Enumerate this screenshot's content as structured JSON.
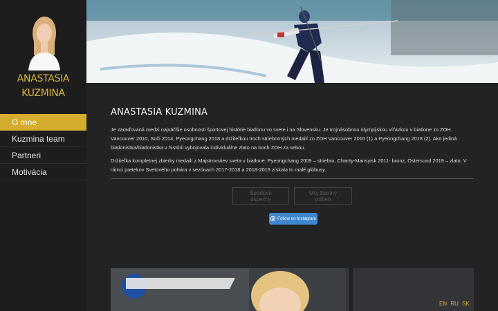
{
  "sidebar": {
    "name_line1": "ANASTASIA",
    "name_line2": "KUZMINA",
    "items": [
      {
        "label": "O mne",
        "active": true
      },
      {
        "label": "Kuzmina team",
        "active": false
      },
      {
        "label": "Partneri",
        "active": false
      },
      {
        "label": "Motivácia",
        "active": false
      }
    ]
  },
  "main": {
    "title": "ANASTASIA KUZMINA",
    "paragraph1": "Je zaraďovaná medzi najväčšie osobnosti športovej histórie biatlonu vo svete i na Slovensku. Je trojnásobnou olympijskou víťazkou v biatlone zo ZOH Vancouver 2010, Soči 2014, Pyeongchang 2018 a držiteľkou troch strieborných medailí zo ZOH Vancouver 2010 (1) a Pyeongchang 2018 (2).  Ako jediná biatlonistka/biatlonistka v histórii vybojovala individuálne zlato na troch ZOH za sebou.",
    "paragraph2": "Držiteľka kompletnej zbierky medailí z Majstrovstiev sveta v biatlone: Pyeongchang 2009 – striebro, Chanty-Mansyisk 2011- bronz, Östersund 2019 – zlato. V rámci pretekov Svetového pohára v sezónach 2017-2018 a 2018-2019 získala tri malé glóbusy.",
    "tabs": [
      {
        "label": "Športové úspechy"
      },
      {
        "label": "Môj životný príbeh"
      }
    ],
    "instagram_label": "Follow on Instagram"
  },
  "languages": [
    "EN",
    "RU",
    "SK"
  ],
  "colors": {
    "accent": "#d5ad2e",
    "background": "#232323",
    "sidebar": "#1d1d1d",
    "instagram": "#3f88cf"
  }
}
